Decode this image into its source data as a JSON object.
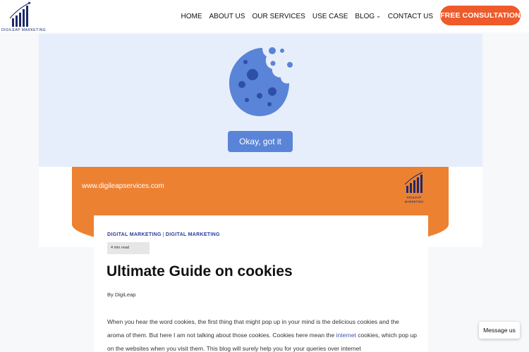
{
  "header": {
    "logo_text": "DIGILEAP MARKETING",
    "nav": [
      {
        "label": "HOME"
      },
      {
        "label": "ABOUT US"
      },
      {
        "label": "OUR SERVICES"
      },
      {
        "label": "USE CASE"
      },
      {
        "label": "BLOG",
        "has_dropdown": true
      },
      {
        "label": "CONTACT US"
      }
    ],
    "cta_label": "FREE CONSULTATION"
  },
  "cookie_banner": {
    "icon": "cookie-icon",
    "button_label": "Okay, got it"
  },
  "hero": {
    "site_url": "www.digileapservices.com",
    "logo_text": "DIGILEAP MARKETING"
  },
  "article": {
    "categories": [
      "DIGITAL MARKETING",
      "DIGITAL MARKETING"
    ],
    "category_separator": "|",
    "read_time": "4 min read",
    "title": "Ultimate Guide on cookies",
    "byline": "By DigiLeap",
    "para_part1": "When you hear the word cookies, the first thing that might pop up in your mind is the delicious cookies and the aroma of them. But here I am not talking about those cookies. Cookies here mean the ",
    "para_link": "internet",
    "para_part2": " cookies, which pop up on the websites when you visit them. This blog will surely help you for your queries over internet"
  },
  "chat": {
    "label": "Message us"
  },
  "colors": {
    "accent": "#ef5a2a",
    "hero_orange": "#ec8132",
    "cookie_blue": "#5a84d8",
    "hero_bg": "#e7eefb",
    "link": "#3a55b4"
  }
}
